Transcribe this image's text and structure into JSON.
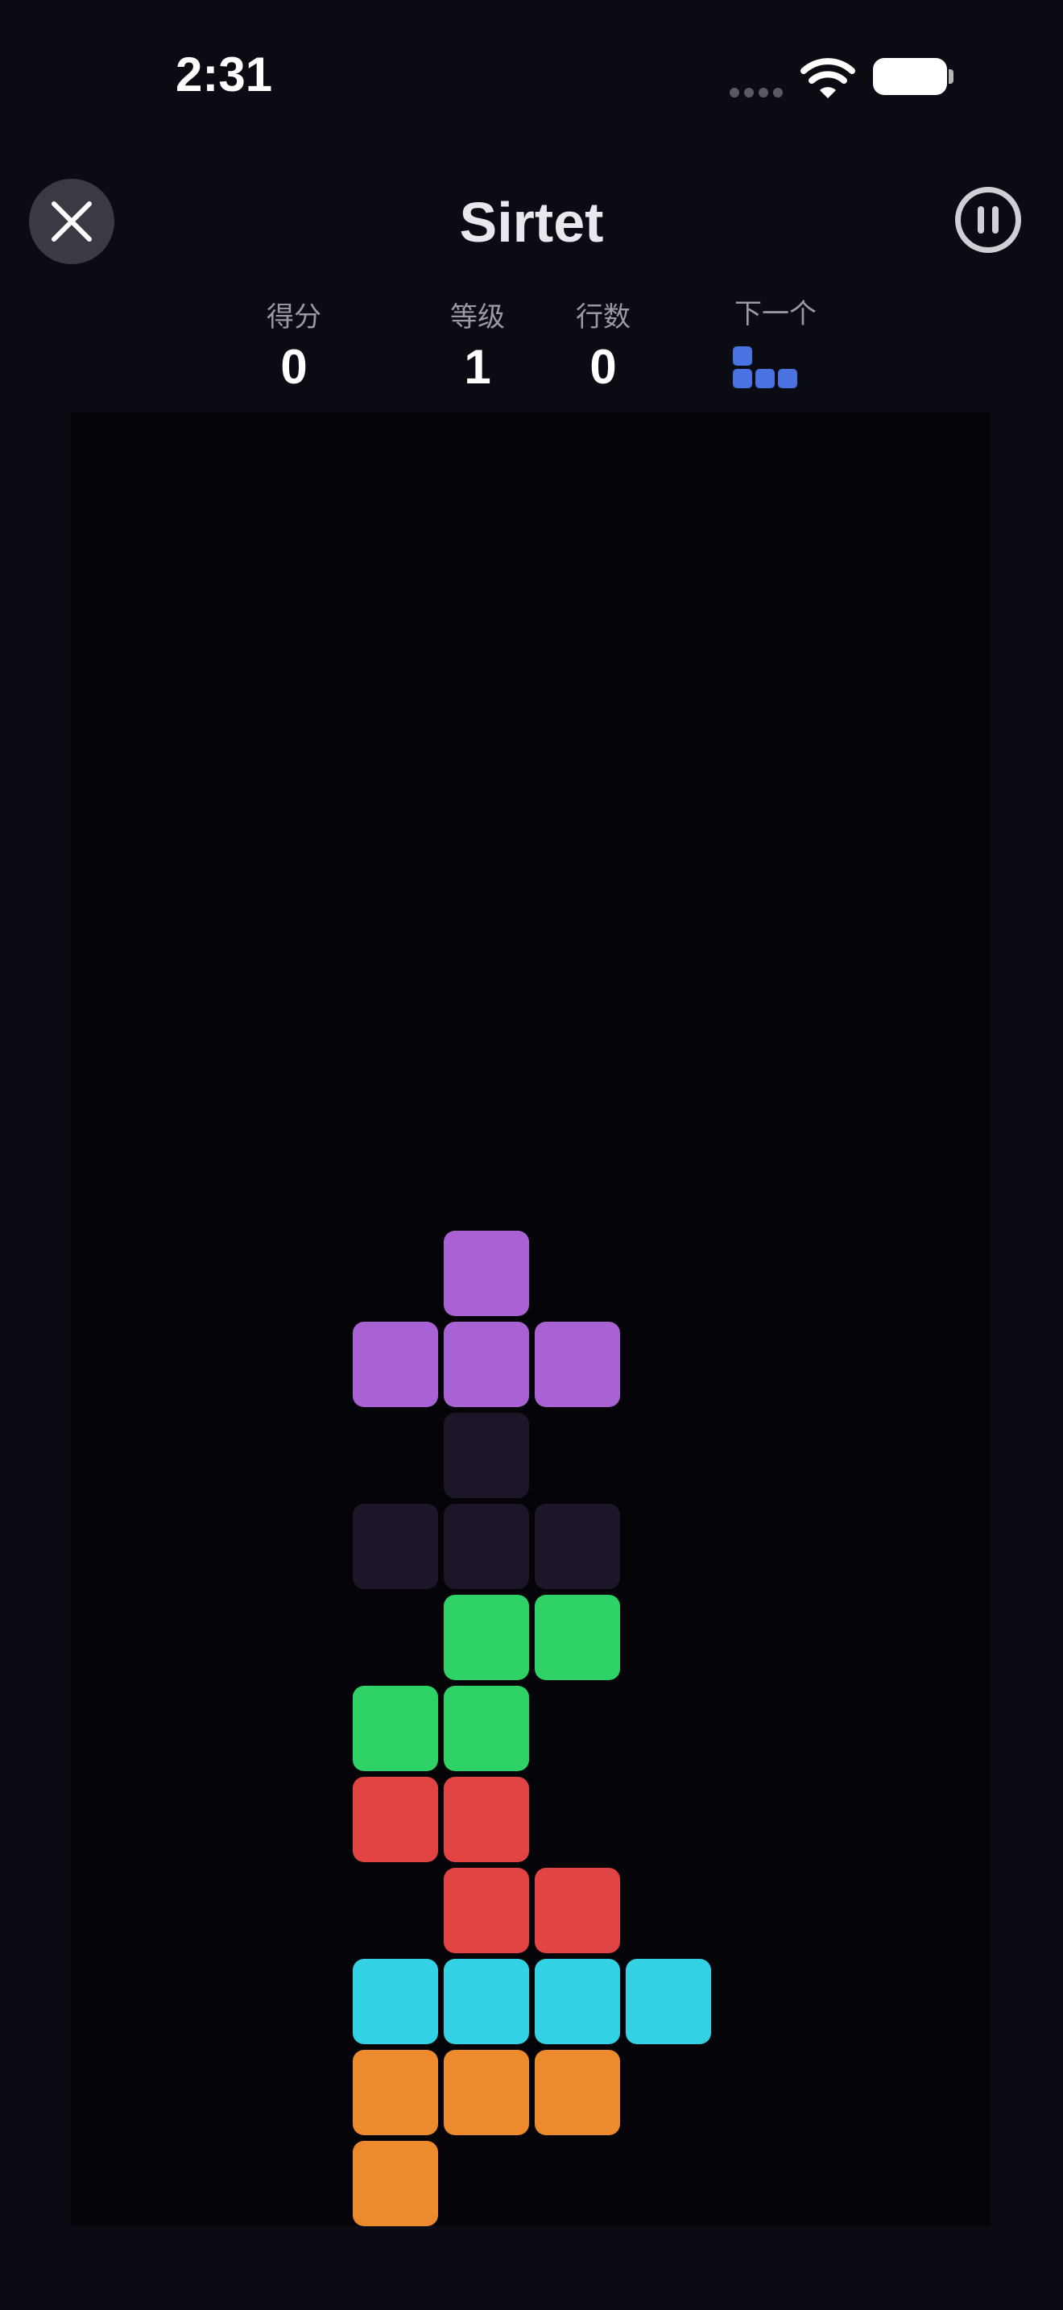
{
  "status_bar": {
    "time": "2:31",
    "icons": [
      "signal-dots-icon",
      "wifi-icon",
      "battery-icon"
    ]
  },
  "header": {
    "title": "Sirtet",
    "close_icon": "close-icon",
    "pause_icon": "pause-icon"
  },
  "stats": {
    "score_label": "得分",
    "score_value": "0",
    "level_label": "等级",
    "level_value": "1",
    "lines_label": "行数",
    "lines_value": "0",
    "next_label": "下一个"
  },
  "next_piece": {
    "type": "J",
    "color": "#4a72e0",
    "cells": [
      [
        0,
        0
      ],
      [
        0,
        1
      ],
      [
        1,
        1
      ],
      [
        2,
        1
      ]
    ]
  },
  "colors": {
    "background": "#0b0b14",
    "board": "#050509",
    "purple": "#a962d3",
    "ghost": "#1e1528",
    "green": "#2ed266",
    "red": "#e24444",
    "cyan": "#32d2e4",
    "orange": "#ee8a2e",
    "blue": "#4a72e0"
  },
  "board": {
    "columns": 10,
    "rows": 20,
    "active_piece": {
      "type": "T",
      "color": "purple",
      "cells": [
        [
          4,
          9
        ],
        [
          3,
          10
        ],
        [
          4,
          10
        ],
        [
          5,
          10
        ]
      ]
    },
    "ghost_piece": {
      "type": "T",
      "color": "ghost",
      "cells": [
        [
          4,
          11
        ],
        [
          3,
          12
        ],
        [
          4,
          12
        ],
        [
          5,
          12
        ]
      ]
    },
    "locked_cells": [
      {
        "col": 4,
        "row": 13,
        "color": "green"
      },
      {
        "col": 5,
        "row": 13,
        "color": "green"
      },
      {
        "col": 3,
        "row": 14,
        "color": "green"
      },
      {
        "col": 4,
        "row": 14,
        "color": "green"
      },
      {
        "col": 3,
        "row": 15,
        "color": "red"
      },
      {
        "col": 4,
        "row": 15,
        "color": "red"
      },
      {
        "col": 4,
        "row": 16,
        "color": "red"
      },
      {
        "col": 5,
        "row": 16,
        "color": "red"
      },
      {
        "col": 3,
        "row": 17,
        "color": "cyan"
      },
      {
        "col": 4,
        "row": 17,
        "color": "cyan"
      },
      {
        "col": 5,
        "row": 17,
        "color": "cyan"
      },
      {
        "col": 6,
        "row": 17,
        "color": "cyan"
      },
      {
        "col": 3,
        "row": 18,
        "color": "orange"
      },
      {
        "col": 4,
        "row": 18,
        "color": "orange"
      },
      {
        "col": 5,
        "row": 18,
        "color": "orange"
      },
      {
        "col": 3,
        "row": 19,
        "color": "orange"
      }
    ]
  }
}
